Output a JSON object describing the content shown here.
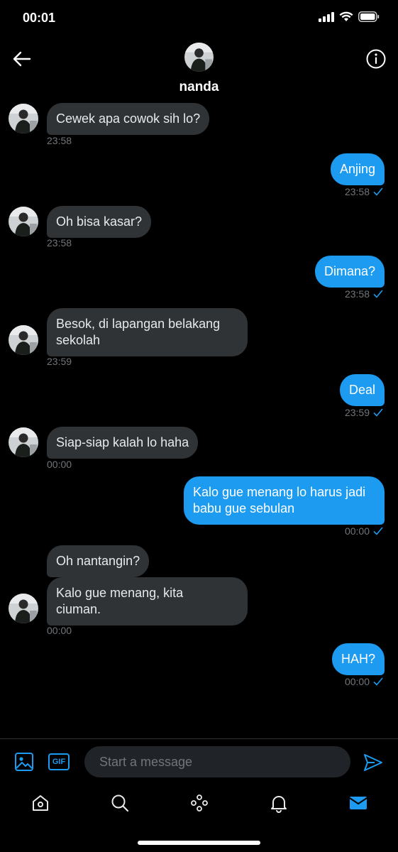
{
  "status_bar": {
    "time": "00:01"
  },
  "header": {
    "name": "nanda"
  },
  "messages": [
    {
      "side": "in",
      "text": "Cewek apa cowok sih lo?",
      "time": "23:58"
    },
    {
      "side": "out",
      "text": "Anjing",
      "time": "23:58"
    },
    {
      "side": "in",
      "text": "Oh bisa kasar?",
      "time": "23:58"
    },
    {
      "side": "out",
      "text": "Dimana?",
      "time": "23:58"
    },
    {
      "side": "in",
      "line1": "Besok, di lapangan belakang",
      "line2": "sekolah",
      "time": "23:59"
    },
    {
      "side": "out",
      "text": "Deal",
      "time": "23:59"
    },
    {
      "side": "in",
      "text": "Siap-siap kalah lo haha",
      "time": "00:00"
    },
    {
      "side": "out",
      "line1": "Kalo gue menang lo harus jadi",
      "line2": "babu gue sebulan",
      "time": "00:00"
    },
    {
      "side": "in",
      "text": "Oh nantangin?"
    },
    {
      "side": "in",
      "line1": "Kalo gue menang, kita",
      "line2": "ciuman.",
      "time": "00:00"
    },
    {
      "side": "out",
      "text": "HAH?",
      "time": "00:00"
    }
  ],
  "composer": {
    "placeholder": "Start a message",
    "gif_label": "GIF"
  },
  "colors": {
    "accent": "#1d9bf0",
    "incoming_bubble": "#2f3336",
    "muted": "#71767b"
  },
  "tabbar": {
    "icons": [
      "home-icon",
      "search-icon",
      "spaces-icon",
      "notifications-icon",
      "messages-icon"
    ]
  }
}
